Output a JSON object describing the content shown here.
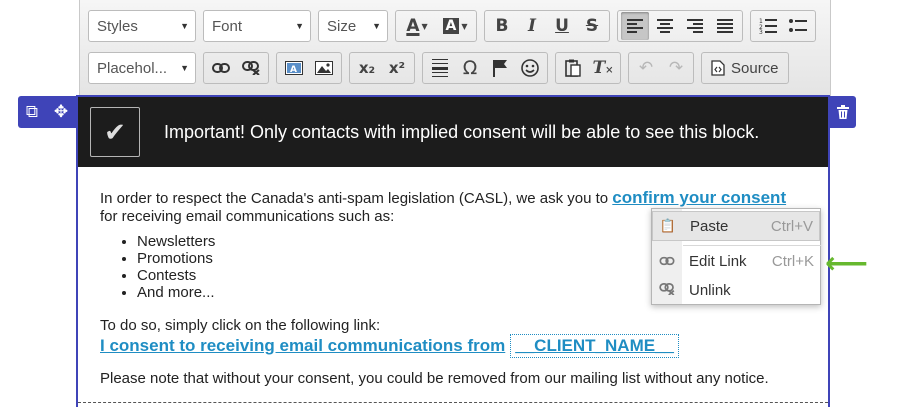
{
  "toolbar": {
    "row1": {
      "styles_label": "Styles",
      "font_label": "Font",
      "size_label": "Size",
      "text_color_glyph": "A",
      "bg_color_glyph": "A",
      "bold_glyph": "B",
      "italic_glyph": "I",
      "underline_glyph": "U",
      "strike_glyph": "S",
      "align_icons": [
        "align-left-icon",
        "align-center-icon",
        "align-right-icon",
        "align-justify-icon"
      ],
      "active_align": "align-left-icon",
      "list_icons": [
        "numbered-list-icon",
        "bulleted-list-icon"
      ]
    },
    "row2": {
      "placeholder_label": "Placehol...",
      "link_icons": [
        "link-icon",
        "unlink-icon"
      ],
      "media_icons": [
        "text-field-icon",
        "image-icon"
      ],
      "subscript_glyph": "x₂",
      "superscript_glyph": "x²",
      "insert_icons": [
        "horizontal-line-icon",
        "omega-icon",
        "anchor-flag-icon",
        "smiley-icon"
      ],
      "clipboard_icons": [
        "paste-icon",
        "remove-format-icon"
      ],
      "history_icons": [
        "undo-icon",
        "redo-icon"
      ],
      "source_label": "Source"
    }
  },
  "banner": {
    "text": "Important! Only contacts with implied consent will be able to see this block."
  },
  "content": {
    "intro_text": "In order to respect the Canada's anti-spam legislation (CASL), we ask you to",
    "confirm_link": "confirm your consent",
    "intro_text_2": "for receiving email communications such as:",
    "bullets": [
      "Newsletters",
      "Promotions",
      "Contests",
      "And more..."
    ],
    "instruction": "To do so, simply click on the following link:",
    "consent_link": "I consent to receiving email communications from",
    "placeholder": "__CLIENT_NAME__",
    "note": "Please note that without your consent, you could be removed from our mailing list without any notice."
  },
  "context_menu": {
    "items": [
      {
        "label": "Paste",
        "shortcut": "Ctrl+V",
        "icon": "paste-icon"
      },
      {
        "label": "Edit Link",
        "shortcut": "Ctrl+K",
        "icon": "link-icon"
      },
      {
        "label": "Unlink",
        "shortcut": "",
        "icon": "unlink-icon"
      }
    ]
  },
  "colors": {
    "accent": "#3f44b8",
    "link": "#1f8dc3",
    "banner_bg": "#1c1c1c",
    "arrow": "#66b82e"
  }
}
